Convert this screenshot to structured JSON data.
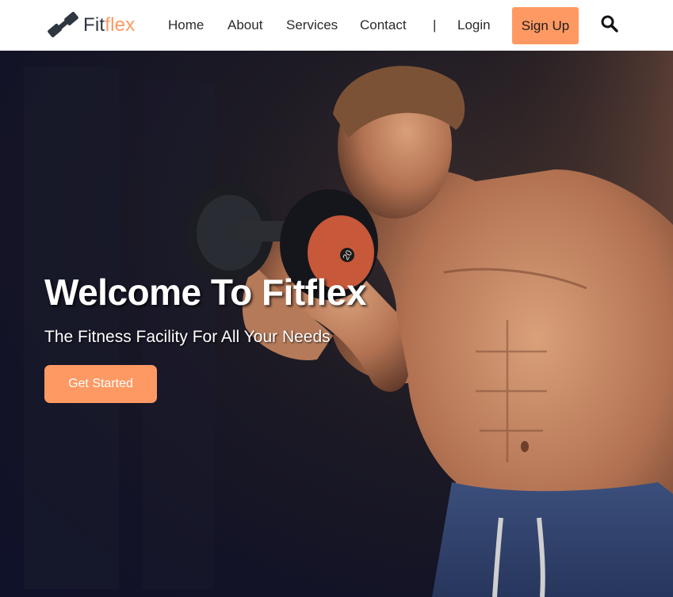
{
  "brand": {
    "name_part1": "Fit",
    "name_part2": "flex",
    "logo_icon": "dumbbell-icon",
    "accent_color": "#ff9963",
    "dark_color": "#2f3640"
  },
  "nav": {
    "links": [
      {
        "label": "Home"
      },
      {
        "label": "About"
      },
      {
        "label": "Services"
      },
      {
        "label": "Contact"
      }
    ],
    "separator": "|",
    "login_label": "Login",
    "signup_label": "Sign Up",
    "search_icon": "search-icon"
  },
  "hero": {
    "title": "Welcome To Fitflex",
    "subtitle": "The Fitness Facility For All Your Needs",
    "cta_label": "Get Started",
    "plate_marking": "20",
    "background_color": "#121326"
  }
}
